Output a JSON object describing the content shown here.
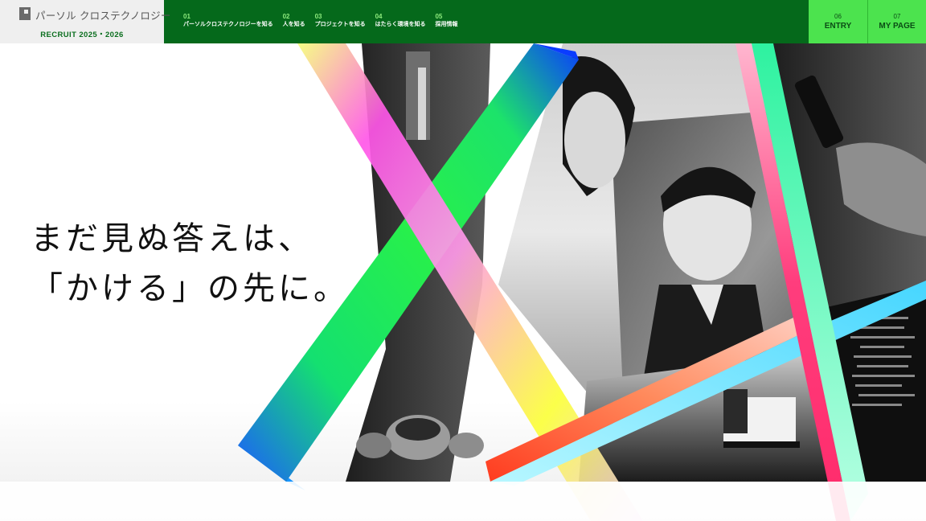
{
  "header": {
    "logo_name": "パーソル クロステクノロジー",
    "logo_sub": "RECRUIT 2025・2026",
    "nav": [
      {
        "num": "01",
        "label": "パーソルクロステクノロジーを知る"
      },
      {
        "num": "02",
        "label": "人を知る"
      },
      {
        "num": "03",
        "label": "プロジェクトを知る"
      },
      {
        "num": "04",
        "label": "はたらく環境を知る"
      },
      {
        "num": "05",
        "label": "採用情報"
      }
    ],
    "entry": {
      "num": "06",
      "label": "ENTRY"
    },
    "mypage": {
      "num": "07",
      "label": "MY PAGE"
    }
  },
  "hero": {
    "catch_line1": "まだ見ぬ答えは、",
    "catch_line2": "「かける」の先に。"
  },
  "colors": {
    "nav_green": "#05691b",
    "cta_green": "#4ce34e",
    "accent_text": "#0a6e1e"
  }
}
